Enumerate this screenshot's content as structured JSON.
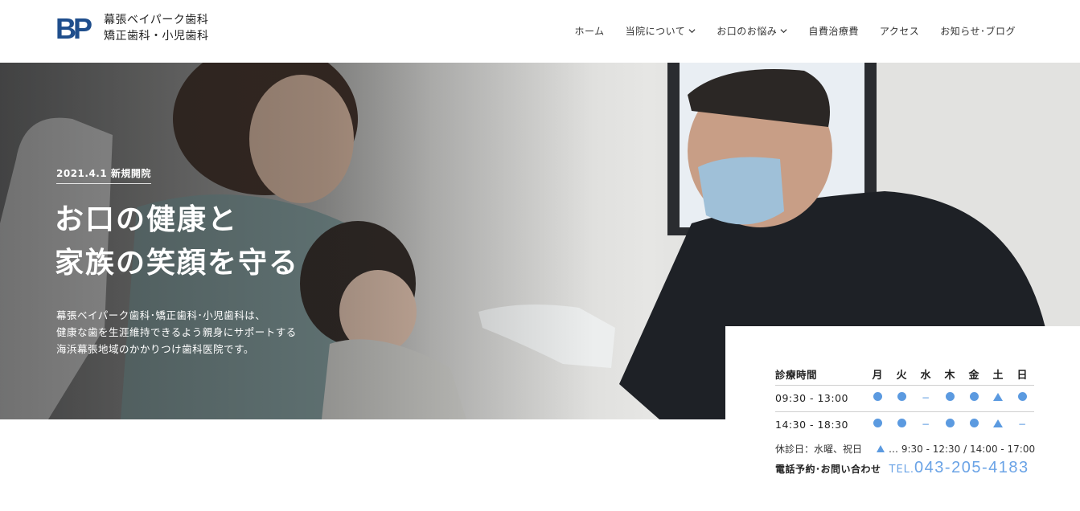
{
  "brand": {
    "logo_text": "BP",
    "line1": "幕張ベイパーク歯科",
    "line2": "矯正歯科・小児歯科",
    "accent_color": "#1f4e8c"
  },
  "nav": {
    "items": [
      {
        "label": "ホーム",
        "dropdown": false
      },
      {
        "label": "当院について",
        "dropdown": true
      },
      {
        "label": "お口のお悩み",
        "dropdown": true
      },
      {
        "label": "自費治療費",
        "dropdown": false
      },
      {
        "label": "アクセス",
        "dropdown": false
      },
      {
        "label": "お知らせ･ブログ",
        "dropdown": false
      }
    ]
  },
  "hero": {
    "badge": "2021.4.1 新規開院",
    "headline_line1": "お口の健康と",
    "headline_line2": "家族の笑顔を守る",
    "lead_line1": "幕張ベイパーク歯科･矯正歯科･小児歯科は、",
    "lead_line2": "健康な歯を生涯維持できるよう親身にサポートする",
    "lead_line3": "海浜幕張地域のかかりつけ歯科医院です。"
  },
  "hours": {
    "header_label": "診療時間",
    "days": [
      "月",
      "火",
      "水",
      "木",
      "金",
      "土",
      "日"
    ],
    "rows": [
      {
        "time": "09:30 - 13:00",
        "marks": [
          "dot",
          "dot",
          "dash",
          "dot",
          "dot",
          "tri",
          "dot"
        ]
      },
      {
        "time": "14:30 - 18:30",
        "marks": [
          "dot",
          "dot",
          "dash",
          "dot",
          "dot",
          "tri",
          "dash"
        ]
      }
    ],
    "closed_label": "休診日：水曜、祝日",
    "triangle_note": "… 9:30 - 12:30 / 14:00 - 17:00",
    "contact_label": "電話予約･お問い合わせ",
    "tel_prefix": "TEL.",
    "tel_number": "043-205-4183",
    "mark_color": "#5b9ae0"
  }
}
